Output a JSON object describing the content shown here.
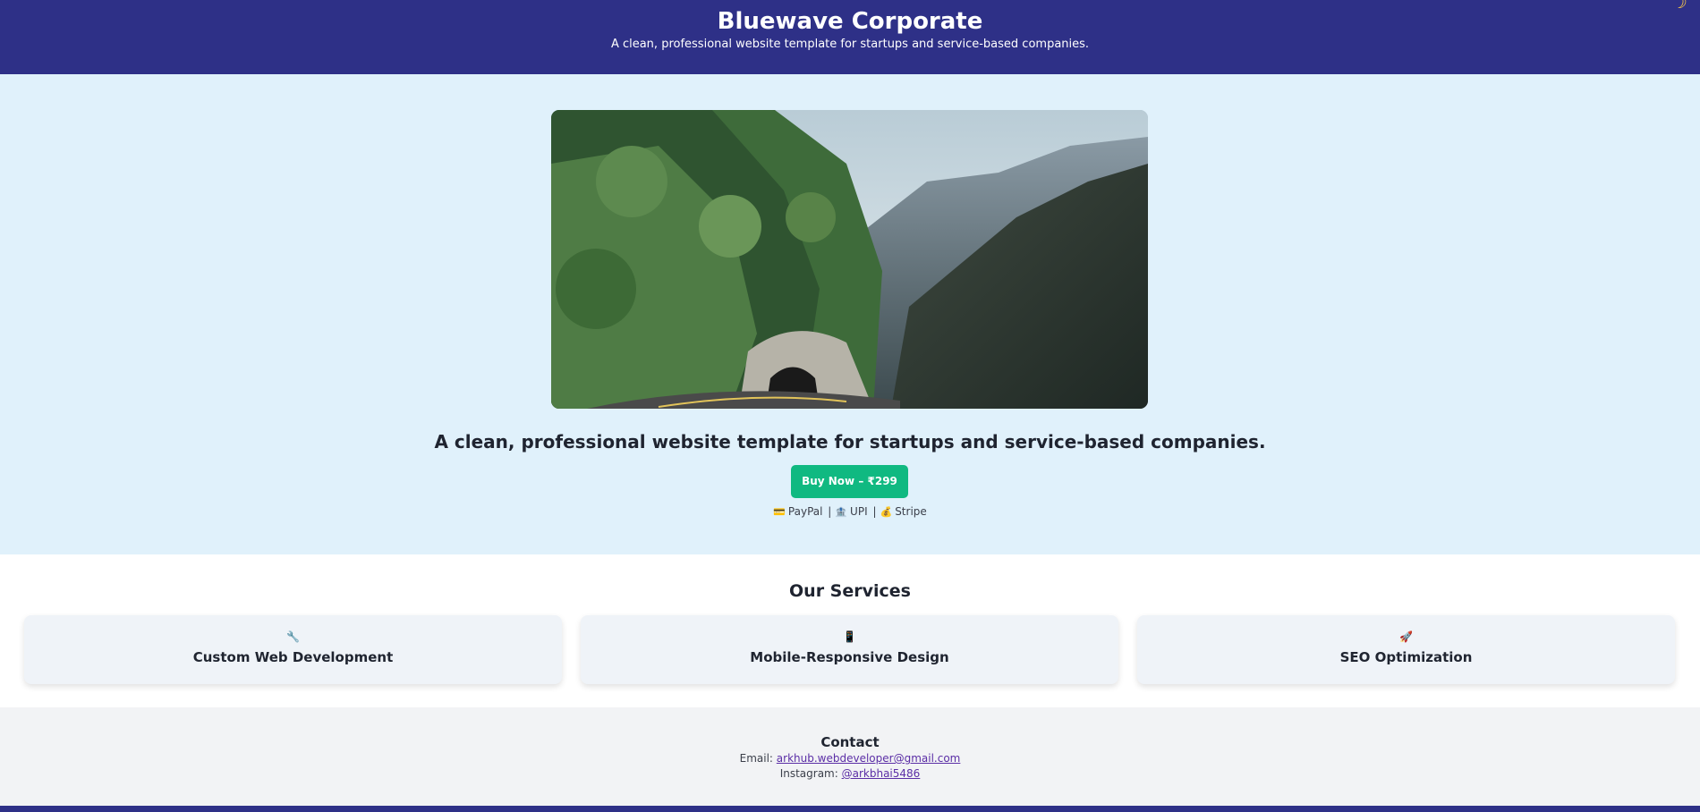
{
  "header": {
    "title": "Bluewave Corporate",
    "tagline": "A clean, professional website template for startups and service-based companies.",
    "theme_toggle_icon": "☽"
  },
  "hero": {
    "heading": "A clean, professional website template for startups and service-based companies.",
    "buy_label": "Buy Now – ₹299",
    "payments": [
      {
        "icon": "credit-card-icon",
        "glyph": "💳",
        "label": "PayPal"
      },
      {
        "icon": "bank-icon",
        "glyph": "🏦",
        "label": "UPI"
      },
      {
        "icon": "money-bag-icon",
        "glyph": "💰",
        "label": "Stripe"
      }
    ],
    "separator": "|"
  },
  "services": {
    "title": "Our Services",
    "items": [
      {
        "icon": "wrench-icon",
        "glyph": "🔧",
        "label": "Custom Web Development"
      },
      {
        "icon": "mobile-phone-icon",
        "glyph": "📱",
        "label": "Mobile-Responsive Design"
      },
      {
        "icon": "rocket-icon",
        "glyph": "🚀",
        "label": "SEO Optimization"
      }
    ]
  },
  "contact": {
    "title": "Contact",
    "email_prefix": "Email:",
    "email": "arkhub.webdeveloper@gmail.com",
    "instagram_prefix": "Instagram:",
    "instagram": "@arkbhai5486"
  },
  "colors": {
    "header_bg": "#2e3087",
    "hero_bg": "#e0f1fb",
    "buy_button": "#10b981",
    "link": "#5b2ea6"
  }
}
